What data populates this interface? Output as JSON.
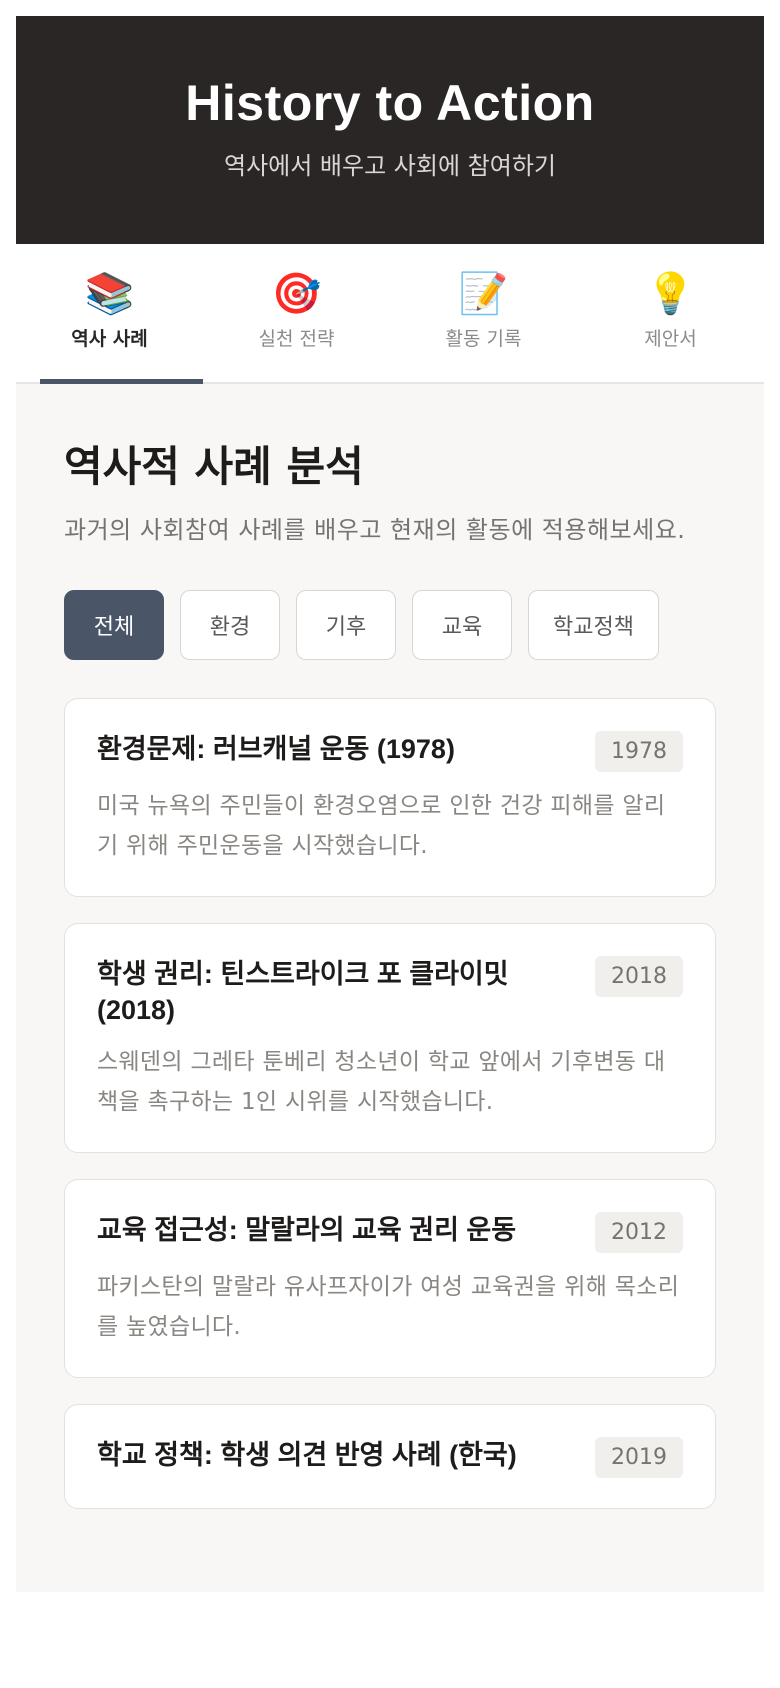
{
  "header": {
    "title": "History to Action",
    "subtitle": "역사에서 배우고 사회에 참여하기"
  },
  "nav": {
    "tabs": [
      {
        "icon": "📚",
        "icon_name": "books-icon",
        "label": "역사 사례",
        "active": true
      },
      {
        "icon": "🎯",
        "icon_name": "target-icon",
        "label": "실천 전략",
        "active": false
      },
      {
        "icon": "📝",
        "icon_name": "memo-icon",
        "label": "활동 기록",
        "active": false
      },
      {
        "icon": "💡",
        "icon_name": "lightbulb-icon",
        "label": "제안서",
        "active": false
      }
    ]
  },
  "main": {
    "title": "역사적 사례 분석",
    "description": "과거의 사회참여 사례를 배우고 현재의 활동에 적용해보세요.",
    "filters": [
      {
        "label": "전체",
        "active": true
      },
      {
        "label": "환경",
        "active": false
      },
      {
        "label": "기후",
        "active": false
      },
      {
        "label": "교육",
        "active": false
      },
      {
        "label": "학교정책",
        "active": false
      }
    ],
    "cases": [
      {
        "title": "환경문제: 러브캐널 운동 (1978)",
        "year": "1978",
        "description": "미국 뉴욕의 주민들이 환경오염으로 인한 건강 피해를 알리기 위해 주민운동을 시작했습니다."
      },
      {
        "title": "학생 권리: 틴스트라이크 포 클라이밋 (2018)",
        "year": "2018",
        "description": "스웨덴의 그레타 툰베리 청소년이 학교 앞에서 기후변동 대책을 촉구하는 1인 시위를 시작했습니다."
      },
      {
        "title": "교육 접근성: 말랄라의 교육 권리 운동",
        "year": "2012",
        "description": "파키스탄의 말랄라 유사프자이가 여성 교육권을 위해 목소리를 높였습니다."
      },
      {
        "title": "학교 정책: 학생 의견 반영 사례 (한국)",
        "year": "2019",
        "description": ""
      }
    ]
  },
  "colors": {
    "header_bg": "#2a2625",
    "accent": "#4a5568",
    "page_bg": "#f8f7f5"
  }
}
